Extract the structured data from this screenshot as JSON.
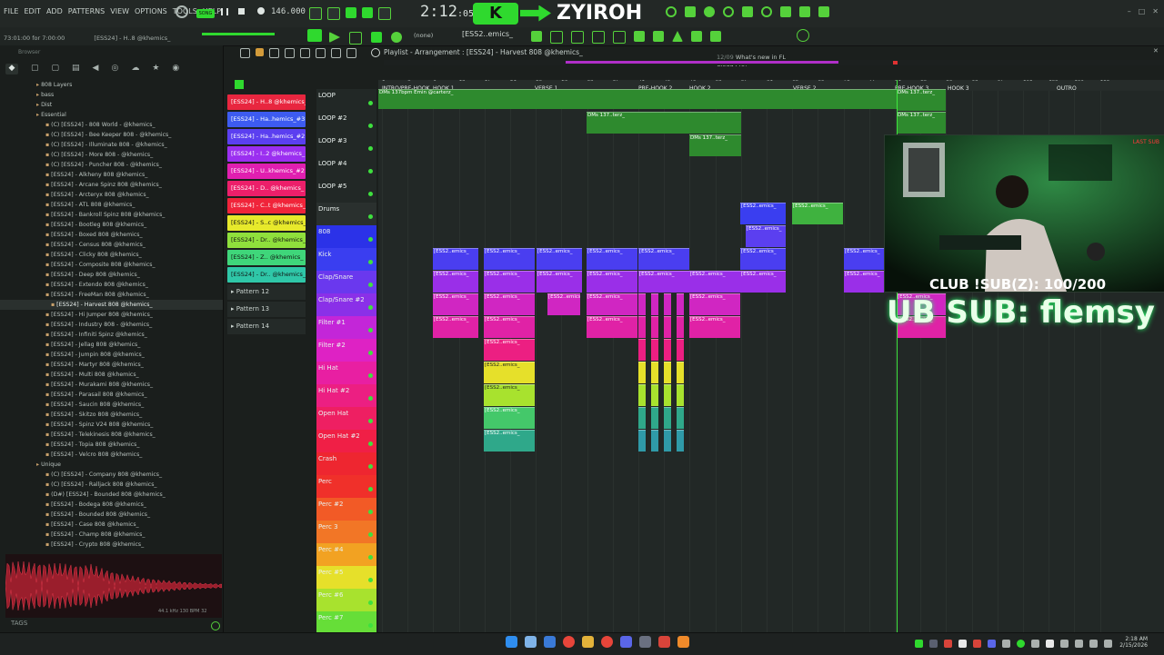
{
  "menu": [
    "FILE",
    "EDIT",
    "ADD",
    "PATTERNS",
    "VIEW",
    "OPTIONS",
    "TOOLS",
    "HELP"
  ],
  "song_mode": "SONG",
  "tempo": "146.000",
  "time_main": "2:12",
  "time_sub": ":05",
  "brand": "ZYIROH",
  "hint_text": "73:01:00 for 7:00:00",
  "hint_channel": "[ESS24] - H..8 @khemics_",
  "pattern_name": "[ESS2..emics_",
  "pattern_select": "(none)",
  "whats_new": {
    "date": "12/09",
    "line1": "What's new in FL",
    "line2": "Cloud Pro?"
  },
  "playlist_title": "Playlist - Arrangement : [ESS24] - Harvest 808 @khemics_",
  "browser_label": "Browser",
  "browser": [
    {
      "t": "808 Layers",
      "d": 1,
      "f": true
    },
    {
      "t": "bass",
      "d": 1,
      "f": true
    },
    {
      "t": "Dist",
      "d": 1,
      "f": true
    },
    {
      "t": "Essential",
      "d": 1,
      "f": true
    },
    {
      "t": "(C) [ESS24] - 808 World - @khemics_",
      "d": 2
    },
    {
      "t": "(C) [ESS24] - Bee Keeper 808 - @khemics_",
      "d": 2
    },
    {
      "t": "(C) [ESS24] - Illuminate 808 - @khemics_",
      "d": 2
    },
    {
      "t": "(C) [ESS24] - More 808 - @khemics_",
      "d": 2
    },
    {
      "t": "(C) [ESS24] - Puncher 808 - @khemics_",
      "d": 2
    },
    {
      "t": "[ESS24] - Alkheny 808 @khemics_",
      "d": 2
    },
    {
      "t": "[ESS24] - Arcane Spinz 808 @khemics_",
      "d": 2
    },
    {
      "t": "[ESS24] - Arcteryx 808 @khemics_",
      "d": 2
    },
    {
      "t": "[ESS24] - ATL 808 @khemics_",
      "d": 2
    },
    {
      "t": "[ESS24] - Bankroll Spinz 808 @khemics_",
      "d": 2
    },
    {
      "t": "[ESS24] - Bootleg 808 @khemics_",
      "d": 2
    },
    {
      "t": "[ESS24] - Boxed 808 @khemics_",
      "d": 2
    },
    {
      "t": "[ESS24] - Census 808 @khemics_",
      "d": 2
    },
    {
      "t": "[ESS24] - Clicky 808 @khemics_",
      "d": 2
    },
    {
      "t": "[ESS24] - Composite 808 @khemics_",
      "d": 2
    },
    {
      "t": "[ESS24] - Deep 808 @khemics_",
      "d": 2
    },
    {
      "t": "[ESS24] - Extendo 808 @khemics_",
      "d": 2
    },
    {
      "t": "[ESS24] - FreeMan 808 @khemics_",
      "d": 2
    },
    {
      "t": "[ESS24] - Harvest 808 @khemics_",
      "d": 3,
      "sel": true
    },
    {
      "t": "[ESS24] - Hi Jumper 808 @khemics_",
      "d": 2
    },
    {
      "t": "[ESS24] - Industry 808 - @khemics_",
      "d": 2
    },
    {
      "t": "[ESS24] - Infiniti Spinz @khemics_",
      "d": 2
    },
    {
      "t": "[ESS24] - Jellag 808 @khemics_",
      "d": 2
    },
    {
      "t": "[ESS24] - Jumpin 808 @khemics_",
      "d": 2
    },
    {
      "t": "[ESS24] - Martyr 808 @khemics_",
      "d": 2
    },
    {
      "t": "[ESS24] - Multi 808 @khemics_",
      "d": 2
    },
    {
      "t": "[ESS24] - Murakami 808 @khemics_",
      "d": 2
    },
    {
      "t": "[ESS24] - Parasail 808 @khemics_",
      "d": 2
    },
    {
      "t": "[ESS24] - Saucin 808 @khemics_",
      "d": 2
    },
    {
      "t": "[ESS24] - Skitzo 808 @khemics_",
      "d": 2
    },
    {
      "t": "[ESS24] - Spinz V24 808 @khemics_",
      "d": 2
    },
    {
      "t": "[ESS24] - Telekinesis 808 @khemics_",
      "d": 2
    },
    {
      "t": "[ESS24] - Topia 808 @khemics_",
      "d": 2
    },
    {
      "t": "[ESS24] - Velcro 808 @khemics_",
      "d": 2
    },
    {
      "t": "Unique",
      "d": 1,
      "f": true
    },
    {
      "t": "(C) [ESS24] - Company 808 @khemics_",
      "d": 2
    },
    {
      "t": "(C) [ESS24] - Ralljack 808 @khemics_",
      "d": 2
    },
    {
      "t": "(D#) [ESS24] - Bounded 808 @khemics_",
      "d": 2
    },
    {
      "t": "[ESS24] - Bodega 808 @khemics_",
      "d": 2
    },
    {
      "t": "[ESS24] - Bounded 808 @khemics_",
      "d": 2
    },
    {
      "t": "[ESS24] - Case 808 @khemics_",
      "d": 2
    },
    {
      "t": "[ESS24] - Champ 808 @khemics_",
      "d": 2
    },
    {
      "t": "[ESS24] - Crypto 808 @khemics_",
      "d": 2
    }
  ],
  "sample_info": "44.1 kHz 130 BPM 32",
  "tags_label": "TAGS",
  "channels": [
    {
      "t": "[ESS24] - H..8 @khemics_",
      "c": "#e8263f"
    },
    {
      "t": "[ESS24] - Ha..hemics_#3",
      "c": "#3d5bf0"
    },
    {
      "t": "[ESS24] - Ha..hemics_#2",
      "c": "#5b3ff0"
    },
    {
      "t": "[ESS24] - I..2 @khemics_",
      "c": "#9b2ff0"
    },
    {
      "t": "[ESS24] - U..khemics_#2",
      "c": "#e01fb0"
    },
    {
      "t": "[ESS24] - D.. @khemics_",
      "c": "#ec1f6a"
    },
    {
      "t": "[ESS24] - C..t @khemics_",
      "c": "#f0243a"
    },
    {
      "t": "[ESS24] - S..c @khemics_",
      "c": "#e7e92b",
      "dark": true
    },
    {
      "t": "[ESS24] - Dr.. @khemics_",
      "c": "#8fe03c",
      "dark": true
    },
    {
      "t": "[ESS24] - Z.. @khemics_",
      "c": "#3fd67a",
      "dark": true
    },
    {
      "t": "[ESS24] - Dr.. @khemics_",
      "c": "#2fc7a8",
      "dark": true
    }
  ],
  "patterns": [
    "Pattern 12",
    "Pattern 13",
    "Pattern 14"
  ],
  "tracks": [
    {
      "t": "LOOP",
      "c": "#222826"
    },
    {
      "t": "LOOP #2",
      "c": "#222826"
    },
    {
      "t": "LOOP #3",
      "c": "#222826"
    },
    {
      "t": "LOOP #4",
      "c": "#222826"
    },
    {
      "t": "LOOP #5",
      "c": "#222826"
    },
    {
      "t": "Drums",
      "c": "#2a302e"
    },
    {
      "t": "808",
      "c": "#2b32e8"
    },
    {
      "t": "Kick",
      "c": "#3a3ef0"
    },
    {
      "t": "Clap/Snare",
      "c": "#6a38ee"
    },
    {
      "t": "Clap/Snare #2",
      "c": "#8a30e8"
    },
    {
      "t": "Filter #1",
      "c": "#c326d8"
    },
    {
      "t": "Filter #2",
      "c": "#de22c4"
    },
    {
      "t": "Hi Hat",
      "c": "#e81fa2"
    },
    {
      "t": "Hi Hat #2",
      "c": "#ec1f82"
    },
    {
      "t": "Open Hat",
      "c": "#ee1f62"
    },
    {
      "t": "Open Hat #2",
      "c": "#f01f46"
    },
    {
      "t": "Crash",
      "c": "#ee2630"
    },
    {
      "t": "Perc",
      "c": "#f0302a"
    },
    {
      "t": "Perc #2",
      "c": "#f25a26"
    },
    {
      "t": "Perc 3",
      "c": "#f27626"
    },
    {
      "t": "Perc #4",
      "c": "#f2a222"
    },
    {
      "t": "Perc #5",
      "c": "#e6e02a"
    },
    {
      "t": "Perc #6",
      "c": "#a8e22e"
    },
    {
      "t": "Perc #7",
      "c": "#66de38"
    }
  ],
  "ruler_nums": [
    "1",
    "5",
    "9",
    "13",
    "17",
    "21",
    "25",
    "29",
    "33",
    "37",
    "41",
    "45",
    "49",
    "53",
    "57",
    "61",
    "65",
    "69",
    "73",
    "77",
    "81",
    "85",
    "89",
    "93",
    "97",
    "101",
    "105",
    "109",
    "113"
  ],
  "markers": [
    "INTRO/PRE-HOOK",
    "HOOK 1",
    "VERSE 1",
    "PRE-HOOK 2",
    "HOOK 2",
    "VERSE 2",
    "PRE-HOOK 3",
    "HOOK 3",
    "OUTRO"
  ],
  "loop_clip_label": "DMs 137bpm Emin @carterz_",
  "loop_short_label": "DMs 137..terz_",
  "drum_clip_label": "[ESS2..emics_",
  "sub_line": "CLUB !SUB(Z): 100/200",
  "sub_big": "UB SUB: flemsy",
  "cam_red": "LAST SUB",
  "clock": {
    "time": "2:18 AM",
    "date": "2/15/2026"
  },
  "colors": {
    "accent": "#55d13b"
  }
}
